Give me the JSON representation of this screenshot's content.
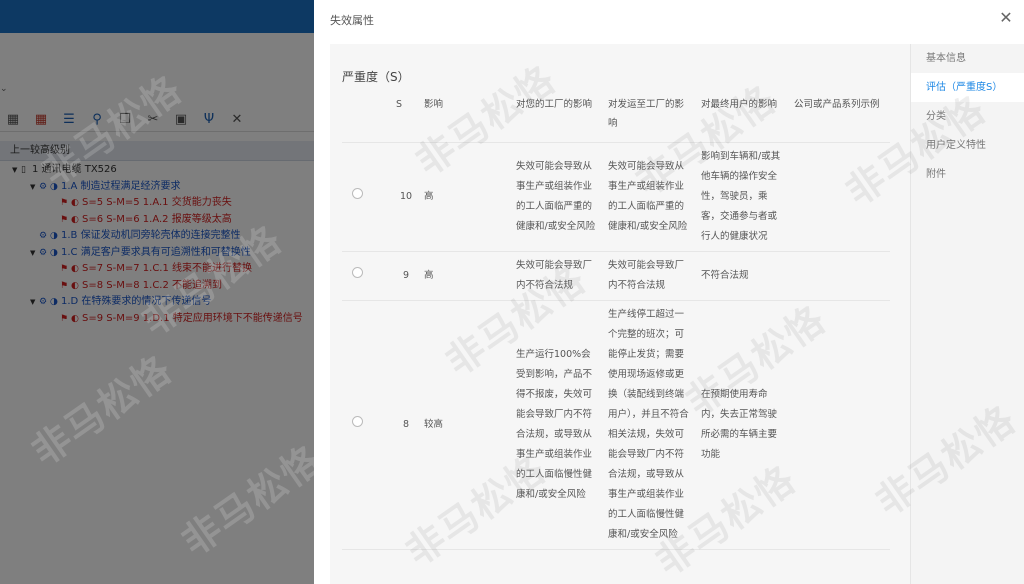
{
  "background": {
    "level_label": "上一较高级别",
    "tree": [
      {
        "level": 0,
        "toggle": "▼",
        "label": "1 通讯电缆 TX526"
      },
      {
        "level": 1,
        "toggle": "▼",
        "label": "1.A 制造过程满足经济要求"
      },
      {
        "level": 2,
        "label": "S=5 S-M=5 1.A.1 交货能力丧失"
      },
      {
        "level": 2,
        "label": "S=6 S-M=6 1.A.2 报废等级太高"
      },
      {
        "level": 1,
        "toggle": "",
        "label": "1.B 保证发动机同旁轮壳体的连接完整性"
      },
      {
        "level": 1,
        "toggle": "▼",
        "label": "1.C 满足客户要求具有可追溯性和可替换性"
      },
      {
        "level": 2,
        "label": "S=7 S-M=7 1.C.1 线束不能进行替换"
      },
      {
        "level": 2,
        "label": "S=8 S-M=8 1.C.2 不能追溯到"
      },
      {
        "level": 1,
        "toggle": "▼",
        "label": "1.D 在特殊要求的情况下传递信号"
      },
      {
        "level": 2,
        "label": "S=9 S-M=9 1.D.1 特定应用环境下不能传递信号"
      }
    ]
  },
  "dialog": {
    "title": "失效属性",
    "section_title": "严重度（S）",
    "nav": [
      {
        "label": "基本信息",
        "active": false
      },
      {
        "label": "评估（严重度S）",
        "active": true
      },
      {
        "label": "分类",
        "active": false
      },
      {
        "label": "用户定义特性",
        "active": false
      },
      {
        "label": "附件",
        "active": false
      }
    ],
    "columns": {
      "s": "S",
      "impact": "影响",
      "plant": "对您的工厂的影响",
      "ship": "对发运至工厂的影响",
      "user": "对最终用户的影响",
      "example": "公司或产品系列示例"
    },
    "rows": [
      {
        "s": "10",
        "impact": "高",
        "plant": "失效可能会导致从事生产或组装作业的工人面临严重的健康和/或安全风险",
        "ship": "失效可能会导致从事生产或组装作业的工人面临严重的健康和/或安全风险",
        "user": "影响到车辆和/或其他车辆的操作安全性，驾驶员，乘客，交通参与者或行人的健康状况",
        "example": ""
      },
      {
        "s": "9",
        "impact": "高",
        "plant": "失效可能会导致厂内不符合法规",
        "ship": "失效可能会导致厂内不符合法规",
        "user": "不符合法规",
        "example": ""
      },
      {
        "s": "8",
        "impact": "较高",
        "plant": "生产运行100%会受到影响，产品不得不报废，失效可能会导致厂内不符合法规，或导致从事生产或组装作业的工人面临慢性健康和/或安全风险",
        "ship": "生产线停工超过一个完整的班次；可能停止发货；需要使用现场返修或更换（装配线到终端用户），并且不符合相关法规，失效可能会导致厂内不符合法规，或导致从事生产或组装作业的工人面临慢性健康和/或安全风险",
        "user": "在预期使用寿命内，失去正常驾驶所必需的车辆主要功能",
        "example": ""
      }
    ]
  },
  "watermark": "非马松恪"
}
